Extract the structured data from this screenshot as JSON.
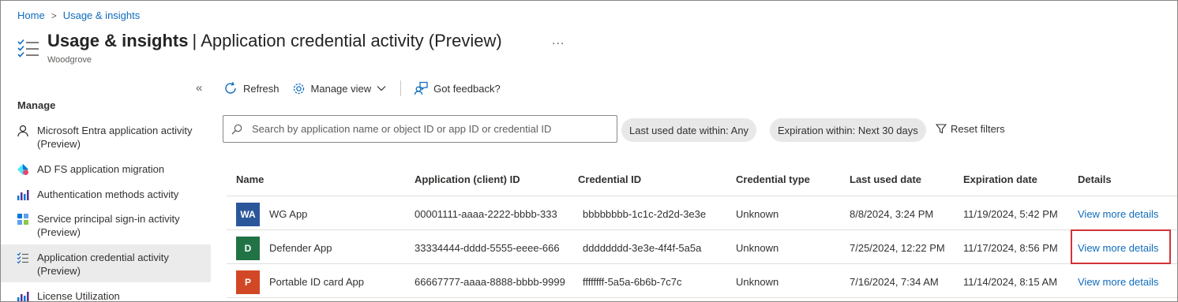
{
  "breadcrumb": {
    "home": "Home",
    "separator": ">",
    "current": "Usage & insights"
  },
  "header": {
    "title_bold": "Usage & insights",
    "title_separator": "|",
    "title_rest": "Application credential activity (Preview)",
    "more": "...",
    "subtitle": "Woodgrove",
    "icon": "checklist-icon"
  },
  "sidebar": {
    "collapse": "«",
    "group_label": "Manage",
    "items": [
      {
        "label": "Microsoft Entra application activity (Preview)",
        "icon": "person-icon"
      },
      {
        "label": "AD FS application migration",
        "icon": "adfs-icon"
      },
      {
        "label": "Authentication methods activity",
        "icon": "bar-chart-icon"
      },
      {
        "label": "Service principal sign-in activity (Preview)",
        "icon": "grid-icon"
      },
      {
        "label": "Application credential activity (Preview)",
        "icon": "checklist-icon",
        "active": true
      },
      {
        "label": "License Utilization",
        "icon": "bar-chart-icon"
      }
    ]
  },
  "toolbar": {
    "refresh": "Refresh",
    "manage_view": "Manage view",
    "feedback": "Got feedback?"
  },
  "filters": {
    "search_placeholder": "Search by application name or object ID or app ID or credential ID",
    "last_used": "Last used date within: Any",
    "expiration": "Expiration within: Next 30 days",
    "reset": "Reset filters"
  },
  "table": {
    "columns": [
      "Name",
      "Application (client) ID",
      "Credential ID",
      "Credential type",
      "Last used date",
      "Expiration date",
      "Details"
    ],
    "rows": [
      {
        "initials": "WA",
        "color": "#2b579a",
        "name": "WG App",
        "app_id": "00001111-aaaa-2222-bbbb-333",
        "credential_id": "bbbbbbbb-1c1c-2d2d-3e3e",
        "type": "Unknown",
        "last_used": "8/8/2024, 3:24 PM",
        "expiration": "11/19/2024, 5:42 PM",
        "details": "View more details"
      },
      {
        "initials": "D",
        "color": "#217346",
        "name": "Defender App",
        "app_id": "33334444-dddd-5555-eeee-666",
        "credential_id": "dddddddd-3e3e-4f4f-5a5a",
        "type": "Unknown",
        "last_used": "7/25/2024, 12:22 PM",
        "expiration": "11/17/2024, 8:56 PM",
        "details": "View more details"
      },
      {
        "initials": "P",
        "color": "#d24726",
        "name": "Portable ID card App",
        "app_id": "66667777-aaaa-8888-bbbb-9999",
        "credential_id": "ffffffff-5a5a-6b6b-7c7c",
        "type": "Unknown",
        "last_used": "7/16/2024, 7:34 AM",
        "expiration": "11/14/2024, 8:15 AM",
        "details": "View more details"
      }
    ]
  },
  "colors": {
    "link": "#0f6cbd",
    "highlight": "#d13438",
    "active_bg": "#ebebeb"
  }
}
